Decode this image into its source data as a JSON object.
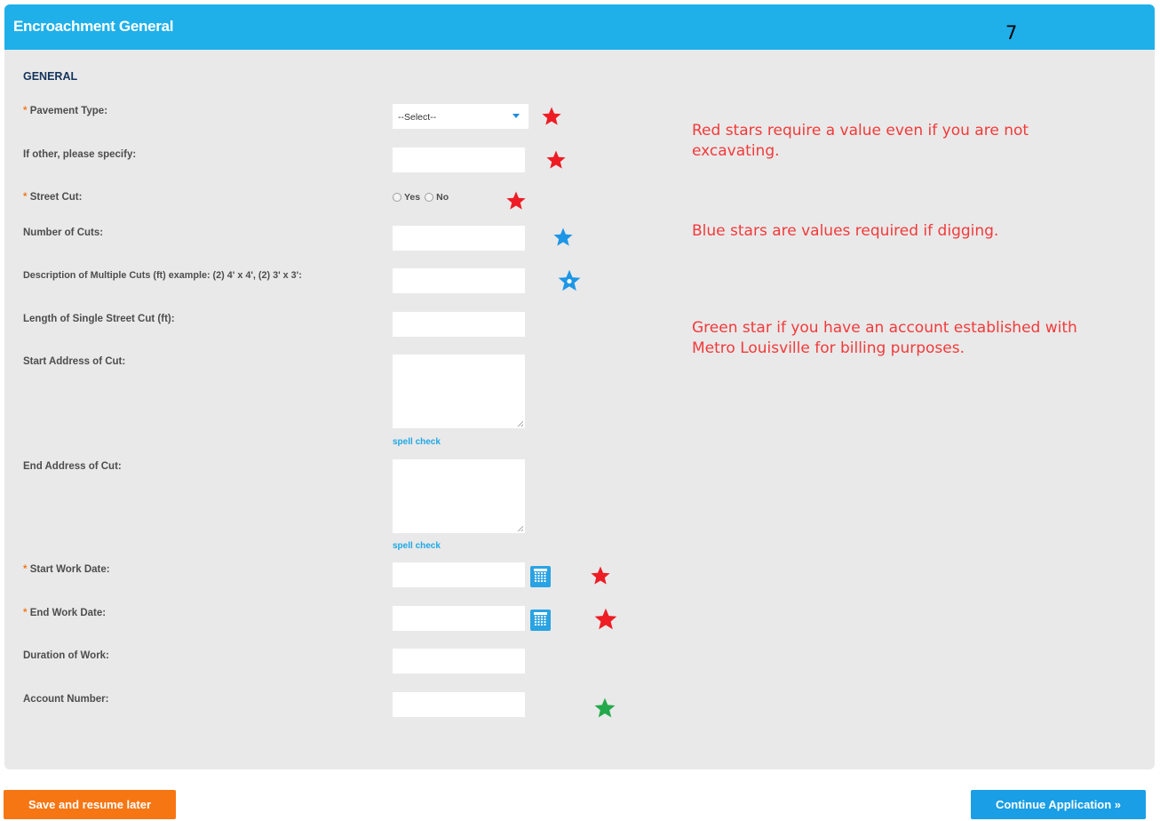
{
  "header": {
    "title": "Encroachment General",
    "page_number": "7"
  },
  "section": {
    "title": "GENERAL"
  },
  "fields": {
    "pavement_type": {
      "required_mark": "*",
      "label": "Pavement Type:",
      "select_value": "--Select--"
    },
    "if_other": {
      "label": "If other, please specify:",
      "value": ""
    },
    "street_cut": {
      "required_mark": "*",
      "label": "Street Cut:",
      "option_yes": "Yes",
      "option_no": "No"
    },
    "number_of_cuts": {
      "label": "Number of Cuts:",
      "value": ""
    },
    "multiple_cuts": {
      "label": "Description of Multiple Cuts (ft) example: (2) 4' x 4', (2) 3' x 3':",
      "value": ""
    },
    "single_cut_length": {
      "label": "Length of Single Street Cut (ft):",
      "value": ""
    },
    "start_address": {
      "label": "Start Address of Cut:",
      "value": "",
      "spell_check": "spell check"
    },
    "end_address": {
      "label": "End Address of Cut:",
      "value": "",
      "spell_check": "spell check"
    },
    "start_work_date": {
      "required_mark": "*",
      "label": "Start Work Date:",
      "value": ""
    },
    "end_work_date": {
      "required_mark": "*",
      "label": "End Work Date:",
      "value": ""
    },
    "duration": {
      "label": "Duration of Work:",
      "value": ""
    },
    "account_number": {
      "label": "Account Number:",
      "value": ""
    }
  },
  "annotations": {
    "red_note": "Red stars require a value even if you are not excavating.",
    "blue_note": "Blue stars are values required if digging.",
    "green_note": "Green star if you have an account established with Metro Louisville for billing purposes.",
    "colors": {
      "red": "#ee1c24",
      "blue": "#1e96e6",
      "green": "#22a94b"
    }
  },
  "buttons": {
    "save_later": "Save and resume later",
    "continue": "Continue Application »"
  },
  "theme": {
    "header_bg": "#1fb0ea",
    "panel_bg": "#e9e9e9",
    "save_bg": "#f77614",
    "continue_bg": "#1a9ee5"
  }
}
